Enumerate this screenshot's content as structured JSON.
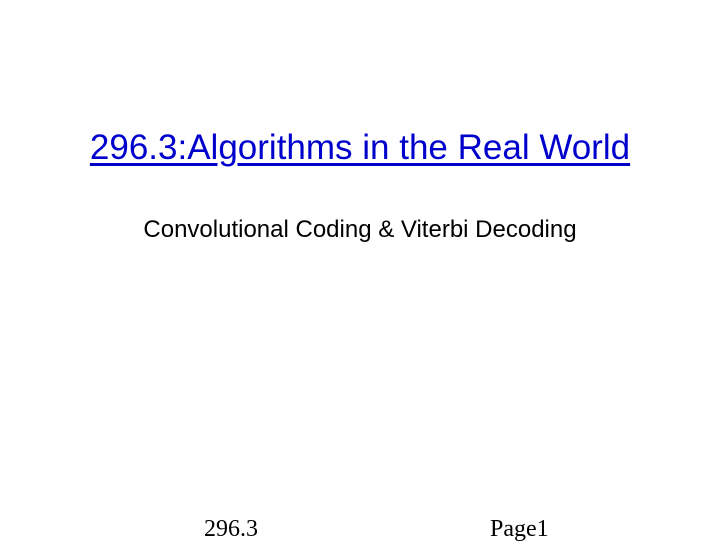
{
  "slide": {
    "title": "296.3:Algorithms in the Real World",
    "subtitle": "Convolutional Coding & Viterbi Decoding"
  },
  "footer": {
    "course": "296.3",
    "page": "Page1"
  }
}
